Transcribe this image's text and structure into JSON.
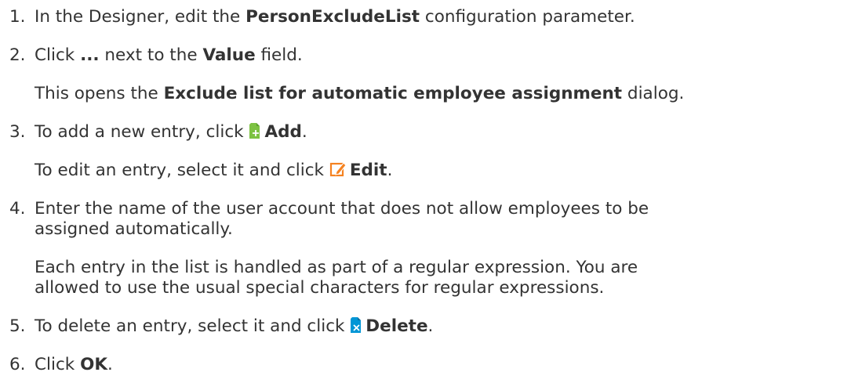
{
  "steps": [
    {
      "number": "1.",
      "parts": [
        "In the Designer, edit the ",
        "PersonExcludeList",
        " configuration parameter."
      ]
    },
    {
      "number": "2.",
      "parts": [
        "Click ",
        "...",
        " next to the ",
        "Value",
        " field."
      ],
      "note": [
        "This opens the ",
        "Exclude list for automatic employee assignment",
        " dialog."
      ]
    },
    {
      "number": "3.",
      "parts": [
        "To add a new entry, click ",
        "Add",
        "."
      ],
      "note": [
        "To edit an entry, select it and click ",
        "Edit",
        "."
      ]
    },
    {
      "number": "4.",
      "line1": "Enter the name of the user account that does not allow employees to be",
      "line2": "assigned automatically.",
      "note1": "Each entry in the list is handled as part of a regular expression. You are",
      "note2": "allowed to use the usual special characters for regular expressions."
    },
    {
      "number": "5.",
      "parts": [
        "To delete an entry, select it and click ",
        "Delete",
        "."
      ]
    },
    {
      "number": "6.",
      "parts": [
        "Click ",
        "OK",
        "."
      ]
    }
  ],
  "icons": {
    "add": "add-document-icon",
    "edit": "edit-pencil-icon",
    "delete": "delete-document-icon",
    "accent_blue": "#0096d6",
    "accent_green": "#7dc242",
    "accent_orange": "#f58220"
  }
}
